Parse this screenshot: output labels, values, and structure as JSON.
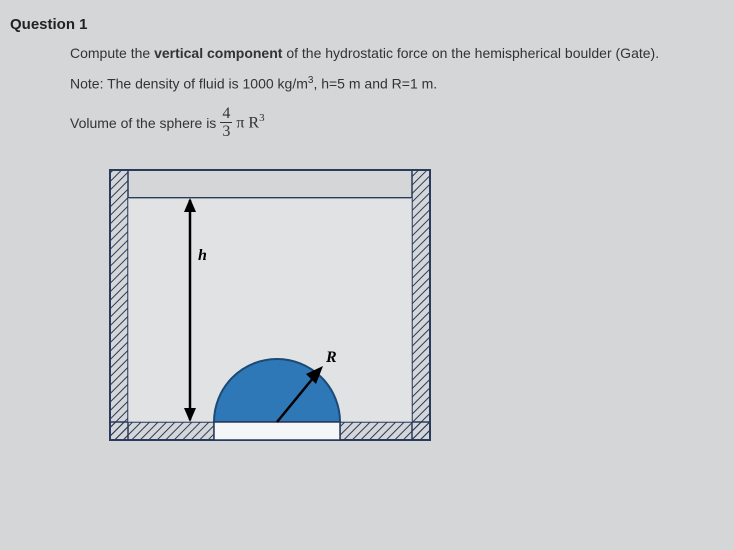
{
  "question": {
    "number": "Question 1",
    "prompt_before": "Compute the ",
    "prompt_bold": "vertical component",
    "prompt_after": " of the hydrostatic force on the hemispherical boulder (Gate).",
    "note_before": "Note: The density of fluid is 1000 kg/m",
    "note_sup1": "3",
    "note_mid": ", h=5 m and R=1 m.",
    "volume_label": "Volume of the sphere is",
    "frac_num": "4",
    "frac_den": "3",
    "formula_pi": "π R",
    "formula_exp": "3"
  },
  "diagram": {
    "label_h": "h",
    "label_R": "R"
  },
  "chart_data": {
    "type": "table",
    "description": "Physics diagram: tank with fluid and hemispherical boulder at bottom",
    "parameters": {
      "density_kg_per_m3": 1000,
      "h_m": 5,
      "R_m": 1
    }
  }
}
